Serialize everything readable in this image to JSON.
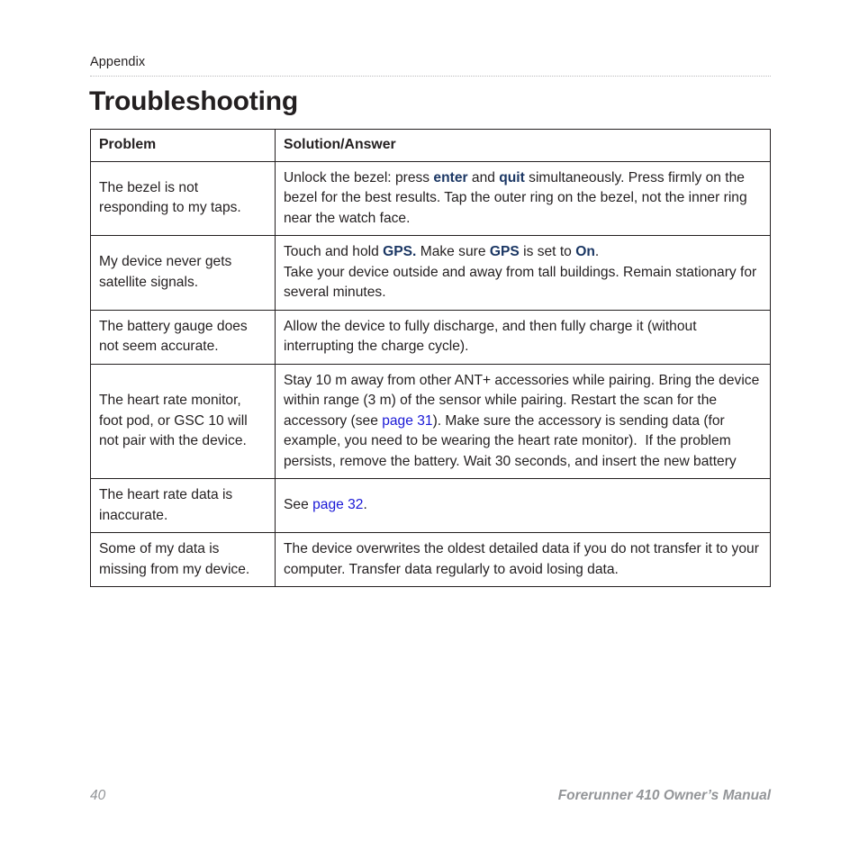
{
  "header": {
    "running_head": "Appendix"
  },
  "title": "Troubleshooting",
  "table": {
    "columns": [
      "Problem",
      "Solution/Answer"
    ],
    "rows": [
      {
        "problem": "The bezel is not responding to my taps.",
        "solution_lines": [
          {
            "parts": [
              {
                "text": "Unlock the bezel: press ",
                "style": "normal"
              },
              {
                "text": "enter",
                "style": "keyword"
              },
              {
                "text": " and ",
                "style": "normal"
              },
              {
                "text": "quit",
                "style": "keyword"
              },
              {
                "text": " simultaneously. Press firmly on the bezel for the best results. Tap the outer ring on the bezel, not the inner ring near the watch face.",
                "style": "normal"
              }
            ]
          }
        ]
      },
      {
        "problem": "My device never gets satellite signals.",
        "solution_lines": [
          {
            "parts": [
              {
                "text": "Touch and hold ",
                "style": "normal"
              },
              {
                "text": "GPS.",
                "style": "keyword"
              },
              {
                "text": " Make sure ",
                "style": "normal"
              },
              {
                "text": "GPS",
                "style": "keyword"
              },
              {
                "text": " is set to ",
                "style": "normal"
              },
              {
                "text": "On",
                "style": "keyword"
              },
              {
                "text": ".",
                "style": "normal"
              }
            ]
          },
          {
            "parts": [
              {
                "text": "Take your device outside and away from tall buildings. Remain stationary for several minutes.",
                "style": "normal"
              }
            ]
          }
        ]
      },
      {
        "problem": "The battery gauge does not seem accurate.",
        "solution_lines": [
          {
            "parts": [
              {
                "text": "Allow the device to fully discharge, and then fully charge it (without interrupting the charge cycle).",
                "style": "normal"
              }
            ]
          }
        ]
      },
      {
        "problem": "The heart rate monitor, foot pod, or GSC 10 will not pair with the device.",
        "solution_lines": [
          {
            "parts": [
              {
                "text": "Stay 10 m away from other ANT+ accessories while pairing. Bring the device within range (3 m) of the sensor while pairing. Restart the scan for the accessory (see ",
                "style": "normal"
              },
              {
                "text": "page 31",
                "style": "xref"
              },
              {
                "text": "). Make sure the accessory is sending data (for example, you need to be wearing the heart rate monitor).  If the problem persists, remove the battery. Wait 30 seconds, and insert the new battery",
                "style": "normal"
              }
            ]
          }
        ]
      },
      {
        "problem": "The heart rate data is inaccurate.",
        "solution_lines": [
          {
            "parts": [
              {
                "text": "See ",
                "style": "normal"
              },
              {
                "text": "page 32",
                "style": "xref"
              },
              {
                "text": ".",
                "style": "normal"
              }
            ]
          }
        ]
      },
      {
        "problem": "Some of my data is missing from my device.",
        "solution_lines": [
          {
            "parts": [
              {
                "text": "The device overwrites the oldest detailed data if you do not transfer it to your computer. Transfer data regularly to avoid losing data.",
                "style": "normal"
              }
            ]
          }
        ]
      }
    ]
  },
  "footer": {
    "page_number": "40",
    "manual_title": "Forerunner 410 Owner’s Manual"
  },
  "colors": {
    "text": "#231f20",
    "keyword_blue": "#1b3764",
    "link_blue": "#1a18d6",
    "footer_gray": "#939598",
    "rule_gray": "#b9babc"
  }
}
